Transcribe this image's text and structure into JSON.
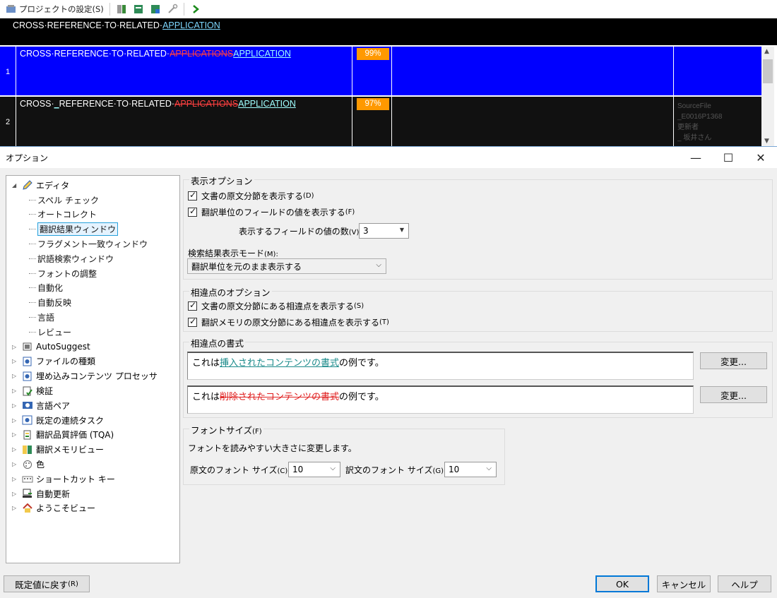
{
  "toolbar": {
    "project_settings_label": "プロジェクトの設定(S)"
  },
  "source_bar": {
    "prefix": "CROSS·REFERENCE·TO·RELATED·",
    "underlined": "APPLICATION"
  },
  "tm_rows": [
    {
      "num": "1",
      "prefix": "CROSS·REFERENCE·TO·RELATED·",
      "deleted": "APPLICATIONS",
      "inserted": "APPLICATION",
      "match": "99%"
    },
    {
      "num": "2",
      "prefix": "CROSS·",
      "inserted_mark": "_",
      "prefix2": "REFERENCE·TO·RELATED·",
      "deleted": "APPLICATIONS",
      "inserted": "APPLICATION",
      "match": "97%",
      "meta_1": "SourceFile",
      "meta_2": "_E0016P1368",
      "meta_3": "更新者",
      "meta_4": "_ 坂井さん"
    }
  ],
  "dialog": {
    "title": "オプション",
    "controls": {
      "minimize": "—",
      "maximize": "☐",
      "close": "✕"
    }
  },
  "tree": {
    "editor": "エディタ",
    "editor_children": [
      "スペル チェック",
      "オートコレクト",
      "翻訳結果ウィンドウ",
      "フラグメント一致ウィンドウ",
      "訳語検索ウィンドウ",
      "フォントの調整",
      "自動化",
      "自動反映",
      "言語",
      "レビュー"
    ],
    "others": [
      "AutoSuggest",
      "ファイルの種類",
      "埋め込みコンテンツ プロセッサ",
      "検証",
      "言語ペア",
      "既定の連続タスク",
      "翻訳品質評価 (TQA)",
      "翻訳メモリビュー",
      "色",
      "ショートカット キー",
      "自動更新",
      "ようこそビュー"
    ]
  },
  "display_options": {
    "title": "表示オプション",
    "show_source_segments": "文書の原文分節を表示する",
    "show_source_segments_key": "(D)",
    "show_field_values": "翻訳単位のフィールドの値を表示する",
    "show_field_values_key": "(F)",
    "field_count_label": "表示するフィールドの値の数",
    "field_count_key": "(V):",
    "field_count_value": "3",
    "search_mode_label": "検索結果表示モード",
    "search_mode_key": "(M):",
    "search_mode_value": "翻訳単位を元のまま表示する"
  },
  "diff_options": {
    "title": "相違点のオプション",
    "show_doc_diffs": "文書の原文分節にある相違点を表示する",
    "show_doc_diffs_key": "(S)",
    "show_tm_diffs": "翻訳メモリの原文分節にある相違点を表示する",
    "show_tm_diffs_key": "(T)"
  },
  "diff_format": {
    "title": "相違点の書式",
    "ins_pre": "これは",
    "ins_text": "挿入されたコンテンツの書式",
    "ins_post": "の例です。",
    "del_pre": "これは",
    "del_text": "削除されたコンテンツの書式",
    "del_post": "の例です。",
    "change_button": "変更..."
  },
  "font_size": {
    "title": "フォントサイズ",
    "title_key": "(F)",
    "description": "フォントを読みやすい大きさに変更します。",
    "source_label": "原文のフォント サイズ",
    "source_key": "(C):",
    "source_value": "10",
    "target_label": "訳文のフォント サイズ",
    "target_key": "(G):",
    "target_value": "10"
  },
  "footer": {
    "reset_label": "既定値に戻す",
    "reset_key": "(R)",
    "ok": "OK",
    "cancel": "キャンセル",
    "help": "ヘルプ"
  },
  "colors": {
    "row_active": "#0000ff",
    "row_inactive": "#111111",
    "match_badge": "#ff9900",
    "accent": "#0078d7"
  }
}
